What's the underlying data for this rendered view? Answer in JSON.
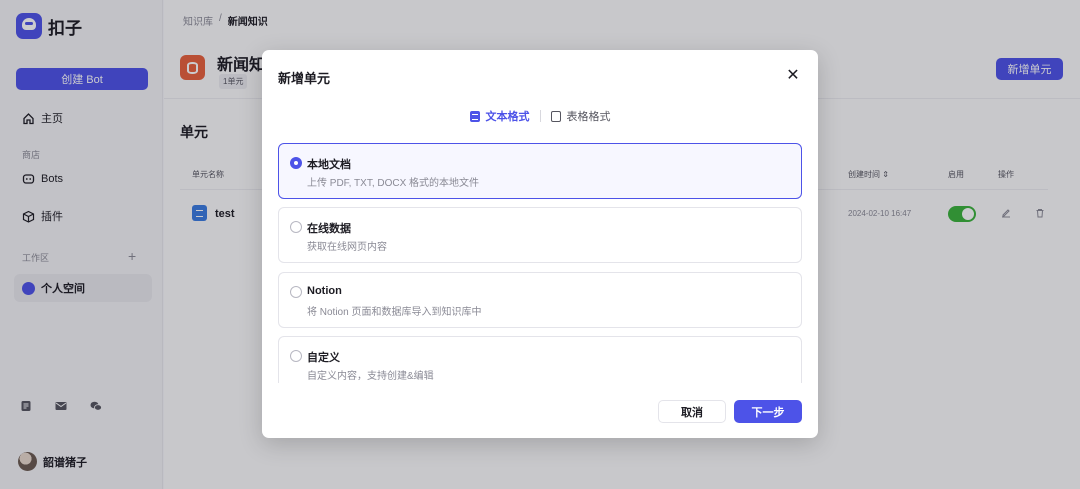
{
  "app": {
    "name": "扣子"
  },
  "sidebar": {
    "create_bot": "创建 Bot",
    "home": "主页",
    "store_label": "商店",
    "bots": "Bots",
    "plugins": "插件",
    "workspace_label": "工作区",
    "workspace_add": "+",
    "personal_space": "个人空间",
    "user_name": "韶谱猪子"
  },
  "breadcrumb": {
    "root": "知识库",
    "sep": "/",
    "current": "新闻知识"
  },
  "knowledge": {
    "title": "新闻知",
    "tag": "1单元",
    "add_unit": "新增单元",
    "section": "单元"
  },
  "table": {
    "headers": {
      "name": "单元名称",
      "created": "创建时间 ⇕",
      "enabled": "启用",
      "actions": "操作"
    },
    "rows": [
      {
        "name": "test",
        "created": "2024-02-10 16:47",
        "enabled": true
      }
    ]
  },
  "modal": {
    "title": "新增单元",
    "close": "✕",
    "tabs": [
      {
        "label": "文本格式",
        "active": true
      },
      {
        "label": "表格格式",
        "active": false
      }
    ],
    "options": [
      {
        "title": "本地文档",
        "desc": "上传 PDF, TXT, DOCX 格式的本地文件",
        "selected": true
      },
      {
        "title": "在线数据",
        "desc": "获取在线网页内容",
        "selected": false
      },
      {
        "title": "Notion",
        "desc": "将 Notion 页面和数据库导入到知识库中",
        "selected": false
      },
      {
        "title": "自定义",
        "desc": "自定义内容，支持创建&编辑",
        "selected": false
      }
    ],
    "cancel": "取消",
    "next": "下一步"
  },
  "colors": {
    "accent": "#4d53e8",
    "toggle_on": "#3ab33a",
    "kb_icon": "#e8613c",
    "doc_icon": "#3a7ce0"
  }
}
